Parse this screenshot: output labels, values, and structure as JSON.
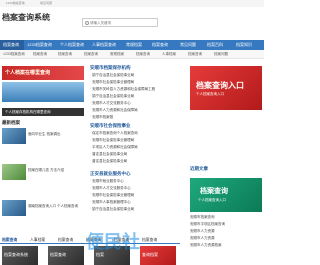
{
  "topbar": {
    "links": [
      "",
      "1233档案查询",
      "常见问题"
    ]
  },
  "header": {
    "title": "档案查询系统",
    "search_placeholder": "请输入关键词"
  },
  "nav": {
    "items": [
      "档案查询",
      "1233档案查询",
      "个人档案查询",
      "人事档案查询",
      "常规档案",
      "档案查询",
      "常见问题",
      "档案百科",
      "档案知识"
    ]
  },
  "subnav": {
    "items": [
      "1233档案查询",
      "档案查询",
      "档案查询",
      "档案查询",
      "常规档案",
      "档案查询",
      "人事档案",
      "档案咨询",
      "档案问题"
    ]
  },
  "banner": {
    "title": "个人档案在哪里查询",
    "caption": "个人档案存档机构在哪里查询"
  },
  "section_left": {
    "title": "最新档案"
  },
  "thumbs": [
    {
      "caption": "面向毕业生 档案调出"
    },
    {
      "caption": "档案在哪儿查 方法介绍"
    },
    {
      "caption": "湖南档案查询入口 个人档案查询"
    }
  ],
  "list1": {
    "head": "安顺市档案保存机构",
    "items": [
      "镇宁自治县社会保险事业局",
      "安顺市社会保险事业管理局",
      "安顺市关岭县人力资源和社会保障局工程",
      "镇宁自治县社会保险事业局",
      "安顺市人才交流服务中心",
      "安顺市人力资源和社会保障局",
      "安顺市档案馆"
    ]
  },
  "list2": {
    "head": "安顺市社会保险事业",
    "items": [
      "保定市档案查询个人档案查询",
      "安顺市社会保险事业管理局",
      "平坝区人力资源和社会保障局",
      "普定县社会保险事业局",
      "普定县社会保险事业局"
    ]
  },
  "list3": {
    "head": "正安县就业服务中心",
    "items": [
      "安顺市就业服务中心",
      "安顺市人才交流服务中心",
      "安顺市社会保险事业管理局",
      "安顺市人事档案管理中心",
      "镇宁自治县社会保险事业局"
    ]
  },
  "right": {
    "ad_title": "档案查询入口",
    "ad_sub": "个人档案查询入口",
    "head": "近期文章",
    "ad2_title": "档案查询",
    "ad2_sub": "个人档案查询入口",
    "items": [
      "安顺市档案查询",
      "安顺市平坝区档案查询",
      "安顺市人力资源",
      "安顺市人力资源",
      "安顺市人力资源档案"
    ]
  },
  "bottom": {
    "tabs": [
      "档案查询",
      "人事档案",
      "档案查询",
      "档案查询",
      "档案查询",
      "档案查询"
    ],
    "cards": [
      "档案查询系统",
      "档案查询",
      "档案",
      "查询档案"
    ]
  },
  "watermark": "便民社"
}
